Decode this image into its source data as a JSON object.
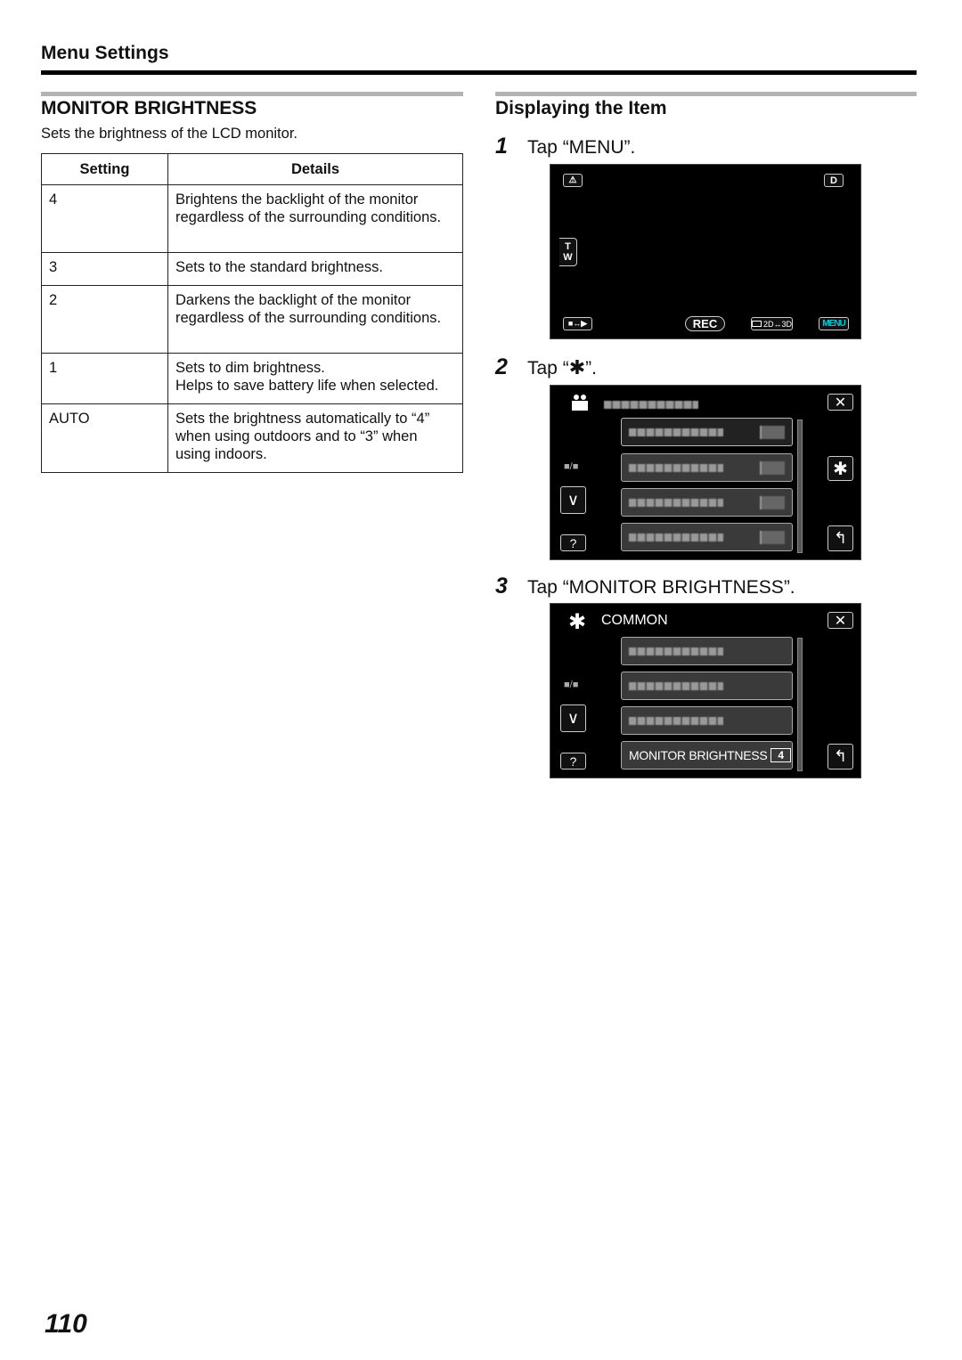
{
  "header": {
    "section_title": "Menu Settings"
  },
  "left": {
    "heading": "MONITOR BRIGHTNESS",
    "description": "Sets the brightness of the LCD monitor.",
    "table": {
      "columns": [
        "Setting",
        "Details"
      ],
      "rows": [
        {
          "setting": "4",
          "details": "Brightens the backlight of the monitor regardless of the surrounding conditions."
        },
        {
          "setting": "3",
          "details": "Sets to the standard brightness."
        },
        {
          "setting": "2",
          "details": "Darkens the backlight of the monitor regardless of the surrounding conditions."
        },
        {
          "setting": "1",
          "details_lines": [
            "Sets to dim brightness.",
            "Helps to save battery life when selected."
          ]
        },
        {
          "setting": "AUTO",
          "details": "Sets the brightness automatically to “4” when using outdoors and to “3” when using indoors."
        }
      ]
    }
  },
  "right": {
    "heading": "Displaying the Item",
    "steps": [
      {
        "number": "1",
        "text": "Tap “MENU”."
      },
      {
        "number": "2",
        "text_before": "Tap “",
        "icon": "gear-icon",
        "text_after": "”."
      },
      {
        "number": "3",
        "text": "Tap “MONITOR BRIGHTNESS”."
      }
    ],
    "screen1": {
      "buttons": {
        "d": "D",
        "t": "T",
        "w": "W",
        "rec": "REC",
        "mode": "2D↔3D",
        "menu": "MENU"
      },
      "menu_color": "#00c8d8"
    },
    "screen2": {
      "page_indicator": "■/■"
    },
    "screen3": {
      "title": "COMMON",
      "page_indicator": "■/■",
      "selected_item": {
        "label": "MONITOR BRIGHTNESS",
        "value": "4"
      }
    }
  },
  "footer": {
    "page_number": "110"
  }
}
